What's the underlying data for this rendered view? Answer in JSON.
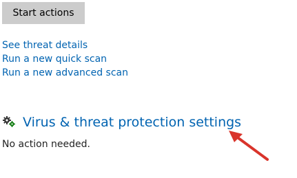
{
  "actions": {
    "start_button_label": "Start actions"
  },
  "links": [
    {
      "label": "See threat details"
    },
    {
      "label": "Run a new quick scan"
    },
    {
      "label": "Run a new advanced scan"
    }
  ],
  "section": {
    "title": "Virus & threat protection settings",
    "icon": "settings-gears-icon",
    "status": "No action needed."
  },
  "colors": {
    "link": "#0063b1",
    "button_bg": "#cccccc",
    "annotation_arrow": "#d9342b"
  }
}
